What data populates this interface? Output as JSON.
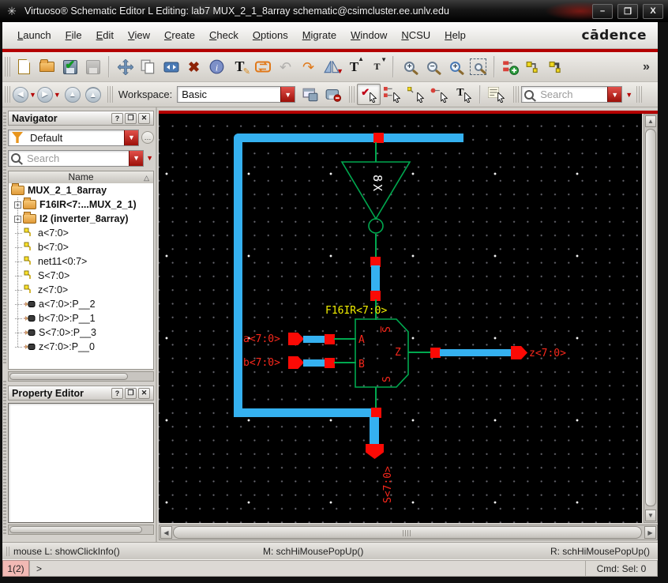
{
  "window": {
    "title": "Virtuoso® Schematic Editor L Editing: lab7 MUX_2_1_8array schematic@csimcluster.ee.unlv.edu",
    "controls": [
      "minimize",
      "maximize",
      "close"
    ]
  },
  "icon_glyphs": {
    "minimize": "–",
    "maximize": "❐",
    "close": "X",
    "overflow": "»"
  },
  "menu": {
    "items": [
      "Launch",
      "File",
      "Edit",
      "View",
      "Create",
      "Check",
      "Options",
      "Migrate",
      "Window",
      "NCSU",
      "Help"
    ],
    "brand": "cādence"
  },
  "toolbar": {
    "workspace_label": "Workspace:",
    "workspace_value": "Basic",
    "search_placeholder": "Search",
    "main_icons": [
      "new-cellview",
      "open",
      "check-and-save",
      "save",
      "move",
      "copy",
      "stretch",
      "delete",
      "properties",
      "edit-text",
      "instance-iterate",
      "undo",
      "redo",
      "rotate-mirror",
      "enlarge-text",
      "shrink-text",
      "zoom-in",
      "zoom-out",
      "zoom-fit",
      "zoom-selected",
      "create-instance",
      "create-wire",
      "create-bus",
      "more-tools"
    ],
    "nav_icons": [
      "back",
      "forward",
      "up",
      "top",
      "save-workspace",
      "delete-workspace",
      "select-all-mode",
      "select-instance-mode",
      "select-wire-mode",
      "select-pin-mode",
      "select-text-mode",
      "property-editor-toggle",
      "search"
    ]
  },
  "navigator": {
    "title": "Navigator",
    "filter_value": "Default",
    "search_placeholder": "Search",
    "column_header": "Name",
    "tree": [
      {
        "label": "MUX_2_1_8array",
        "icon": "folder",
        "bold": true
      },
      {
        "label": "F16IR<7:...MUX_2_1)",
        "icon": "folder",
        "bold": true,
        "expandable": true
      },
      {
        "label": "I2 (inverter_8array)",
        "icon": "folder",
        "bold": true,
        "expandable": true
      },
      {
        "label": "a<7:0>",
        "icon": "wire"
      },
      {
        "label": "b<7:0>",
        "icon": "wire"
      },
      {
        "label": "net11<0:7>",
        "icon": "wire"
      },
      {
        "label": "S<7:0>",
        "icon": "wire"
      },
      {
        "label": "z<7:0>",
        "icon": "wire"
      },
      {
        "label": "a<7:0>:P__2",
        "icon": "pin"
      },
      {
        "label": "b<7:0>:P__1",
        "icon": "pin"
      },
      {
        "label": "S<7:0>:P__3",
        "icon": "pin"
      },
      {
        "label": "z<7:0>:P__0",
        "icon": "pin"
      }
    ]
  },
  "property_editor": {
    "title": "Property Editor"
  },
  "schematic": {
    "instance_label": "F16IR<7:0>",
    "inverter_label": "8X",
    "mux_port_labels": {
      "a": "A",
      "b": "B",
      "out": "Z",
      "sel_top": "S",
      "sel_bottom": "S"
    },
    "port_labels": {
      "a": "a<7:0>",
      "b": "b<7:0>",
      "z": "z<7:0>",
      "s": "S<7:0>"
    },
    "colors": {
      "bus": "#35b1f0",
      "wire": "#00a84f",
      "pin": "#fb0a05",
      "label": "#f8281c",
      "instance_label": "#f2ef00",
      "background": "#000000"
    }
  },
  "statusbar": {
    "left": "mouse L: showClickInfo()",
    "middle": "M: schHiMousePopUp()",
    "right": "R: schHiMousePopUp()"
  },
  "cmdline": {
    "badge": "1(2)",
    "prompt": ">",
    "right": "Cmd: Sel: 0"
  }
}
